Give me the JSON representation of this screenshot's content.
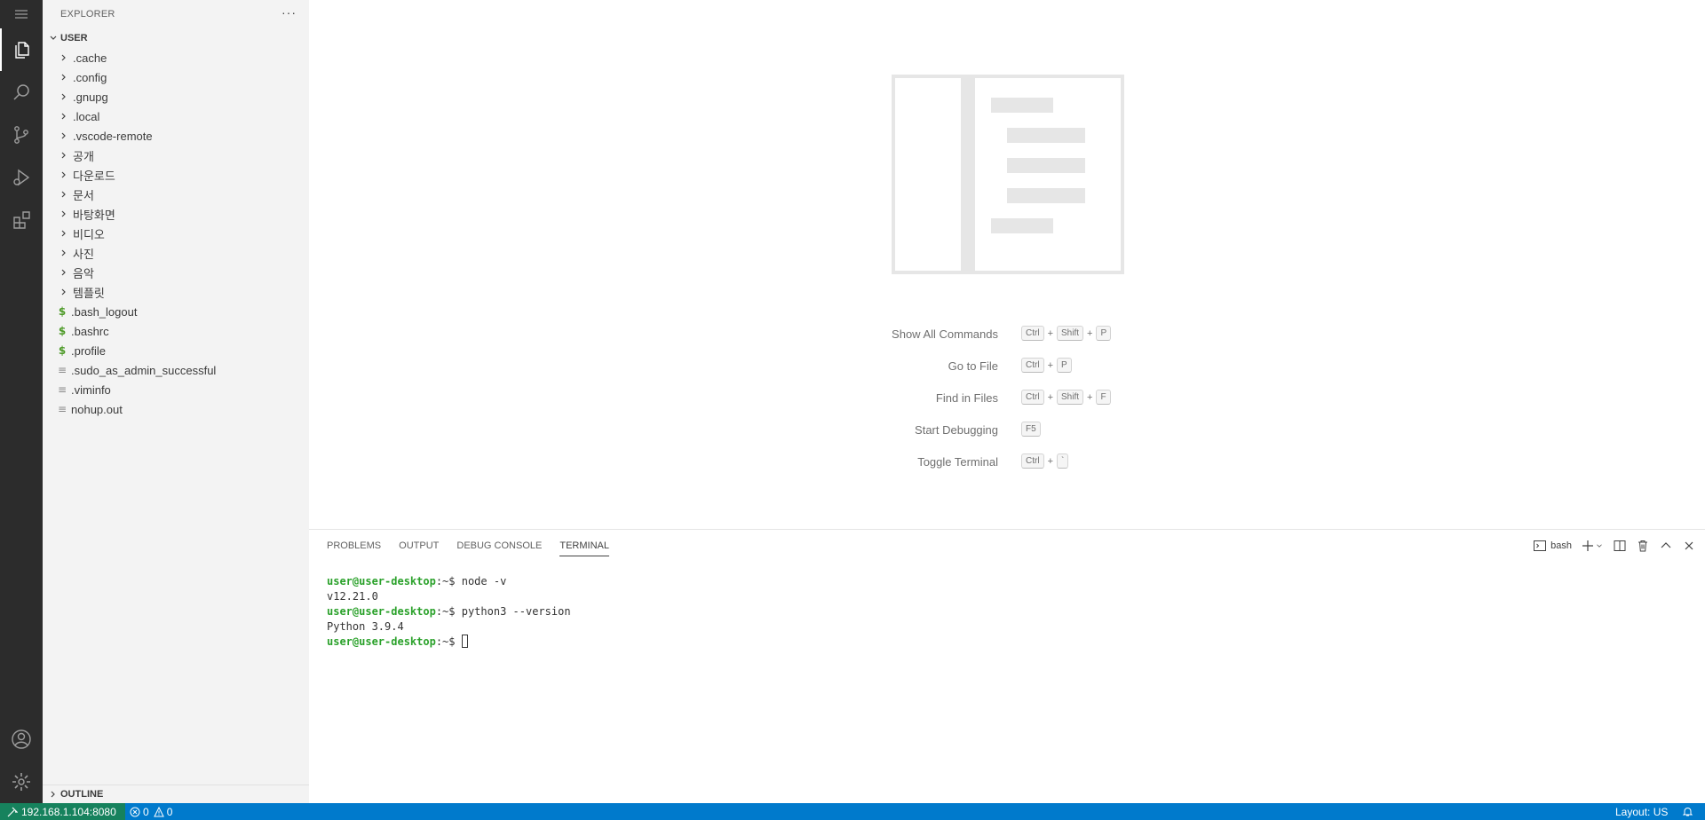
{
  "activity_bar": {
    "items": [
      "menu-icon",
      "files-icon",
      "search-icon",
      "source-control-icon",
      "run-debug-icon",
      "extensions-icon"
    ],
    "bottom_items": [
      "account-icon",
      "settings-gear-icon"
    ]
  },
  "sidebar": {
    "title": "EXPLORER",
    "more": "···",
    "root_label": "USER",
    "folders": [
      ".cache",
      ".config",
      ".gnupg",
      ".local",
      ".vscode-remote",
      "공개",
      "다운로드",
      "문서",
      "바탕화면",
      "비디오",
      "사진",
      "음악",
      "템플릿"
    ],
    "files": [
      {
        "name": ".bash_logout",
        "icon": "$"
      },
      {
        "name": ".bashrc",
        "icon": "$"
      },
      {
        "name": ".profile",
        "icon": "$"
      },
      {
        "name": ".sudo_as_admin_successful",
        "icon": "≡"
      },
      {
        "name": ".viminfo",
        "icon": "≡"
      },
      {
        "name": "nohup.out",
        "icon": "≡"
      }
    ],
    "outline_label": "OUTLINE"
  },
  "editor": {
    "shortcuts": [
      {
        "label": "Show All Commands",
        "keys": [
          "Ctrl",
          "Shift",
          "P"
        ]
      },
      {
        "label": "Go to File",
        "keys": [
          "Ctrl",
          "P"
        ]
      },
      {
        "label": "Find in Files",
        "keys": [
          "Ctrl",
          "Shift",
          "F"
        ]
      },
      {
        "label": "Start Debugging",
        "keys": [
          "F5"
        ]
      },
      {
        "label": "Toggle Terminal",
        "keys": [
          "Ctrl",
          "`"
        ]
      }
    ]
  },
  "panel": {
    "tabs": [
      "PROBLEMS",
      "OUTPUT",
      "DEBUG CONSOLE",
      "TERMINAL"
    ],
    "active_tab": "TERMINAL",
    "terminal_name": "bash",
    "lines": [
      {
        "user": "user@user-desktop",
        "rest": ":~$ node -v"
      },
      {
        "output": "v12.21.0"
      },
      {
        "user": "user@user-desktop",
        "rest": ":~$ python3 --version"
      },
      {
        "output": "Python 3.9.4"
      },
      {
        "user": "user@user-desktop",
        "rest": ":~$ ",
        "cursor": true
      }
    ]
  },
  "statusbar": {
    "remote": "192.168.1.104:8080",
    "errors": "0",
    "warnings": "0",
    "layout": "Layout: US"
  },
  "colors": {
    "activity_bar": "#2c2c2c",
    "sidebar": "#f3f3f3",
    "statusbar": "#007acc",
    "remote": "#16825d",
    "prompt": "#2aa12a"
  }
}
